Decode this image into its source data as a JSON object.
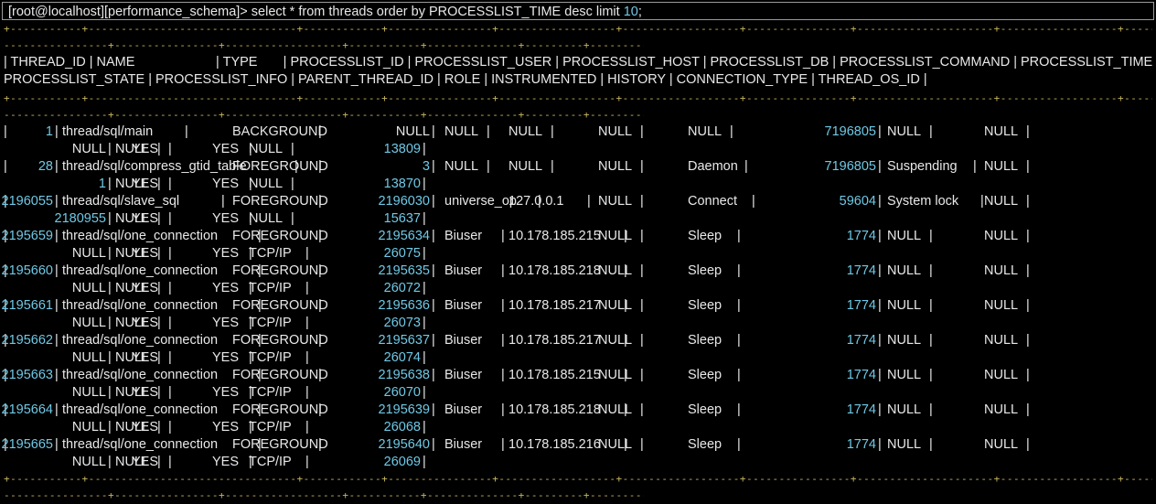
{
  "prompt": {
    "text": "[root@localhost][performance_schema]> select * from threads order by PROCESSLIST_TIME desc limit ",
    "limit": "10",
    "end": ";"
  },
  "separators": {
    "long": "+-----------+--------------------------------+------------+----------------+------------------+------------------+----------------+---------------------+------------------+---------------------------+---------------------------+",
    "short": "----------------+----------------+------------------+-----------+--------------+---------+-----------------+------------------+"
  },
  "header": {
    "line1": "| THREAD_ID | NAME                      | TYPE       | PROCESSLIST_ID | PROCESSLIST_USER | PROCESSLIST_HOST | PROCESSLIST_DB | PROCESSLIST_COMMAND | PROCESSLIST_TIME |",
    "line2": "PROCESSLIST_STATE | PROCESSLIST_INFO | PARENT_THREAD_ID | ROLE | INSTRUMENTED | HISTORY | CONNECTION_TYPE | THREAD_OS_ID |"
  },
  "rows": [
    {
      "thread_id": "1",
      "name": "thread/sql/main",
      "type": "BACKGROUND",
      "processlist_id": "NULL",
      "user": "NULL",
      "host": "NULL",
      "db": "NULL",
      "command": "NULL",
      "time": "7196805",
      "state": "NULL",
      "info": "NULL",
      "parent": "NULL",
      "role": "NULL",
      "instrumented": "YES",
      "history": "YES",
      "conn_type": "NULL",
      "os_id": "13809"
    },
    {
      "thread_id": "28",
      "name": "thread/sql/compress_gtid_table",
      "type": "FOREGROUND",
      "processlist_id": "3",
      "user": "NULL",
      "host": "NULL",
      "db": "NULL",
      "command": "Daemon",
      "time": "7196805",
      "state": "Suspending",
      "info": "NULL",
      "parent": "1",
      "role": "NULL",
      "instrumented": "YES",
      "history": "YES",
      "conn_type": "NULL",
      "os_id": "13870"
    },
    {
      "thread_id": "2196055",
      "name": "thread/sql/slave_sql",
      "type": "FOREGROUND",
      "processlist_id": "2196030",
      "user": "universe_op",
      "host": "127.0.0.1",
      "db": "NULL",
      "command": "Connect",
      "time": "59604",
      "state": "System lock",
      "info": "NULL",
      "parent": "2180955",
      "role": "NULL",
      "instrumented": "YES",
      "history": "YES",
      "conn_type": "NULL",
      "os_id": "15637"
    },
    {
      "thread_id": "2195659",
      "name": "thread/sql/one_connection",
      "type": "FOREGROUND",
      "processlist_id": "2195634",
      "user": "Biuser",
      "host": "10.178.185.215",
      "db": "NULL",
      "command": "Sleep",
      "time": "1774",
      "state": "NULL",
      "info": "NULL",
      "parent": "NULL",
      "role": "NULL",
      "instrumented": "YES",
      "history": "YES",
      "conn_type": "TCP/IP",
      "os_id": "26075"
    },
    {
      "thread_id": "2195660",
      "name": "thread/sql/one_connection",
      "type": "FOREGROUND",
      "processlist_id": "2195635",
      "user": "Biuser",
      "host": "10.178.185.218",
      "db": "NULL",
      "command": "Sleep",
      "time": "1774",
      "state": "NULL",
      "info": "NULL",
      "parent": "NULL",
      "role": "NULL",
      "instrumented": "YES",
      "history": "YES",
      "conn_type": "TCP/IP",
      "os_id": "26072"
    },
    {
      "thread_id": "2195661",
      "name": "thread/sql/one_connection",
      "type": "FOREGROUND",
      "processlist_id": "2195636",
      "user": "Biuser",
      "host": "10.178.185.217",
      "db": "NULL",
      "command": "Sleep",
      "time": "1774",
      "state": "NULL",
      "info": "NULL",
      "parent": "NULL",
      "role": "NULL",
      "instrumented": "YES",
      "history": "YES",
      "conn_type": "TCP/IP",
      "os_id": "26073"
    },
    {
      "thread_id": "2195662",
      "name": "thread/sql/one_connection",
      "type": "FOREGROUND",
      "processlist_id": "2195637",
      "user": "Biuser",
      "host": "10.178.185.217",
      "db": "NULL",
      "command": "Sleep",
      "time": "1774",
      "state": "NULL",
      "info": "NULL",
      "parent": "NULL",
      "role": "NULL",
      "instrumented": "YES",
      "history": "YES",
      "conn_type": "TCP/IP",
      "os_id": "26074"
    },
    {
      "thread_id": "2195663",
      "name": "thread/sql/one_connection",
      "type": "FOREGROUND",
      "processlist_id": "2195638",
      "user": "Biuser",
      "host": "10.178.185.215",
      "db": "NULL",
      "command": "Sleep",
      "time": "1774",
      "state": "NULL",
      "info": "NULL",
      "parent": "NULL",
      "role": "NULL",
      "instrumented": "YES",
      "history": "YES",
      "conn_type": "TCP/IP",
      "os_id": "26070"
    },
    {
      "thread_id": "2195664",
      "name": "thread/sql/one_connection",
      "type": "FOREGROUND",
      "processlist_id": "2195639",
      "user": "Biuser",
      "host": "10.178.185.218",
      "db": "NULL",
      "command": "Sleep",
      "time": "1774",
      "state": "NULL",
      "info": "NULL",
      "parent": "NULL",
      "role": "NULL",
      "instrumented": "YES",
      "history": "YES",
      "conn_type": "TCP/IP",
      "os_id": "26068"
    },
    {
      "thread_id": "2195665",
      "name": "thread/sql/one_connection",
      "type": "FOREGROUND",
      "processlist_id": "2195640",
      "user": "Biuser",
      "host": "10.178.185.216",
      "db": "NULL",
      "command": "Sleep",
      "time": "1774",
      "state": "NULL",
      "info": "NULL",
      "parent": "NULL",
      "role": "NULL",
      "instrumented": "YES",
      "history": "YES",
      "conn_type": "TCP/IP",
      "os_id": "26069"
    }
  ]
}
